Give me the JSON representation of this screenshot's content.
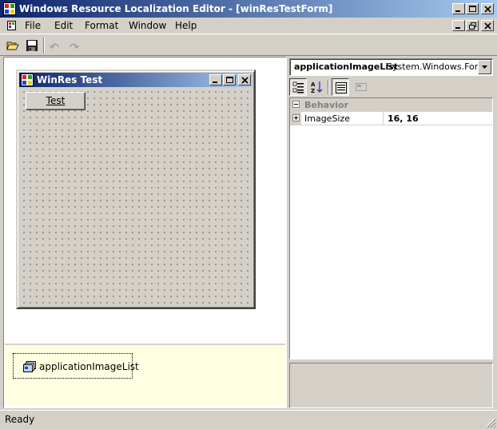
{
  "window": {
    "title": "Windows Resource Localization Editor - [winResTestForm]",
    "app_icon": "winres-app-icon",
    "caption_buttons": [
      "minimize-icon",
      "maximize-icon",
      "close-icon"
    ]
  },
  "menubar": {
    "doc_icon": "document-icon",
    "items": [
      {
        "label": "File"
      },
      {
        "label": "Edit"
      },
      {
        "label": "Format"
      },
      {
        "label": "Window"
      },
      {
        "label": "Help"
      }
    ],
    "mdi_buttons": [
      "minimize-icon",
      "restore-icon",
      "close-icon"
    ]
  },
  "toolbar": {
    "buttons": [
      {
        "icon": "open-folder-icon",
        "enabled": true
      },
      {
        "icon": "save-icon",
        "enabled": true
      },
      {
        "icon": "undo-icon",
        "enabled": false
      },
      {
        "icon": "redo-icon",
        "enabled": false
      }
    ]
  },
  "designer": {
    "form": {
      "title": "WinRes Test",
      "button_label": "Test"
    },
    "tray": {
      "component_label": "applicationImageList",
      "component_icon": "image-list-icon"
    }
  },
  "properties": {
    "object_name": "applicationImageList",
    "object_type": "System.Windows.Form",
    "toolbar": [
      "categorized-icon",
      "alphabetical-icon",
      "properties-icon",
      "events-icon"
    ],
    "categories": [
      {
        "name": "Behavior",
        "properties": [
          {
            "name": "ImageSize",
            "value": "16, 16"
          }
        ]
      }
    ]
  },
  "statusbar": {
    "text": "Ready"
  },
  "colors": {
    "titlebar_start": "#0a246a",
    "titlebar_end": "#a6caf0",
    "face": "#d4d0c8",
    "tray": "#ffffe1"
  }
}
